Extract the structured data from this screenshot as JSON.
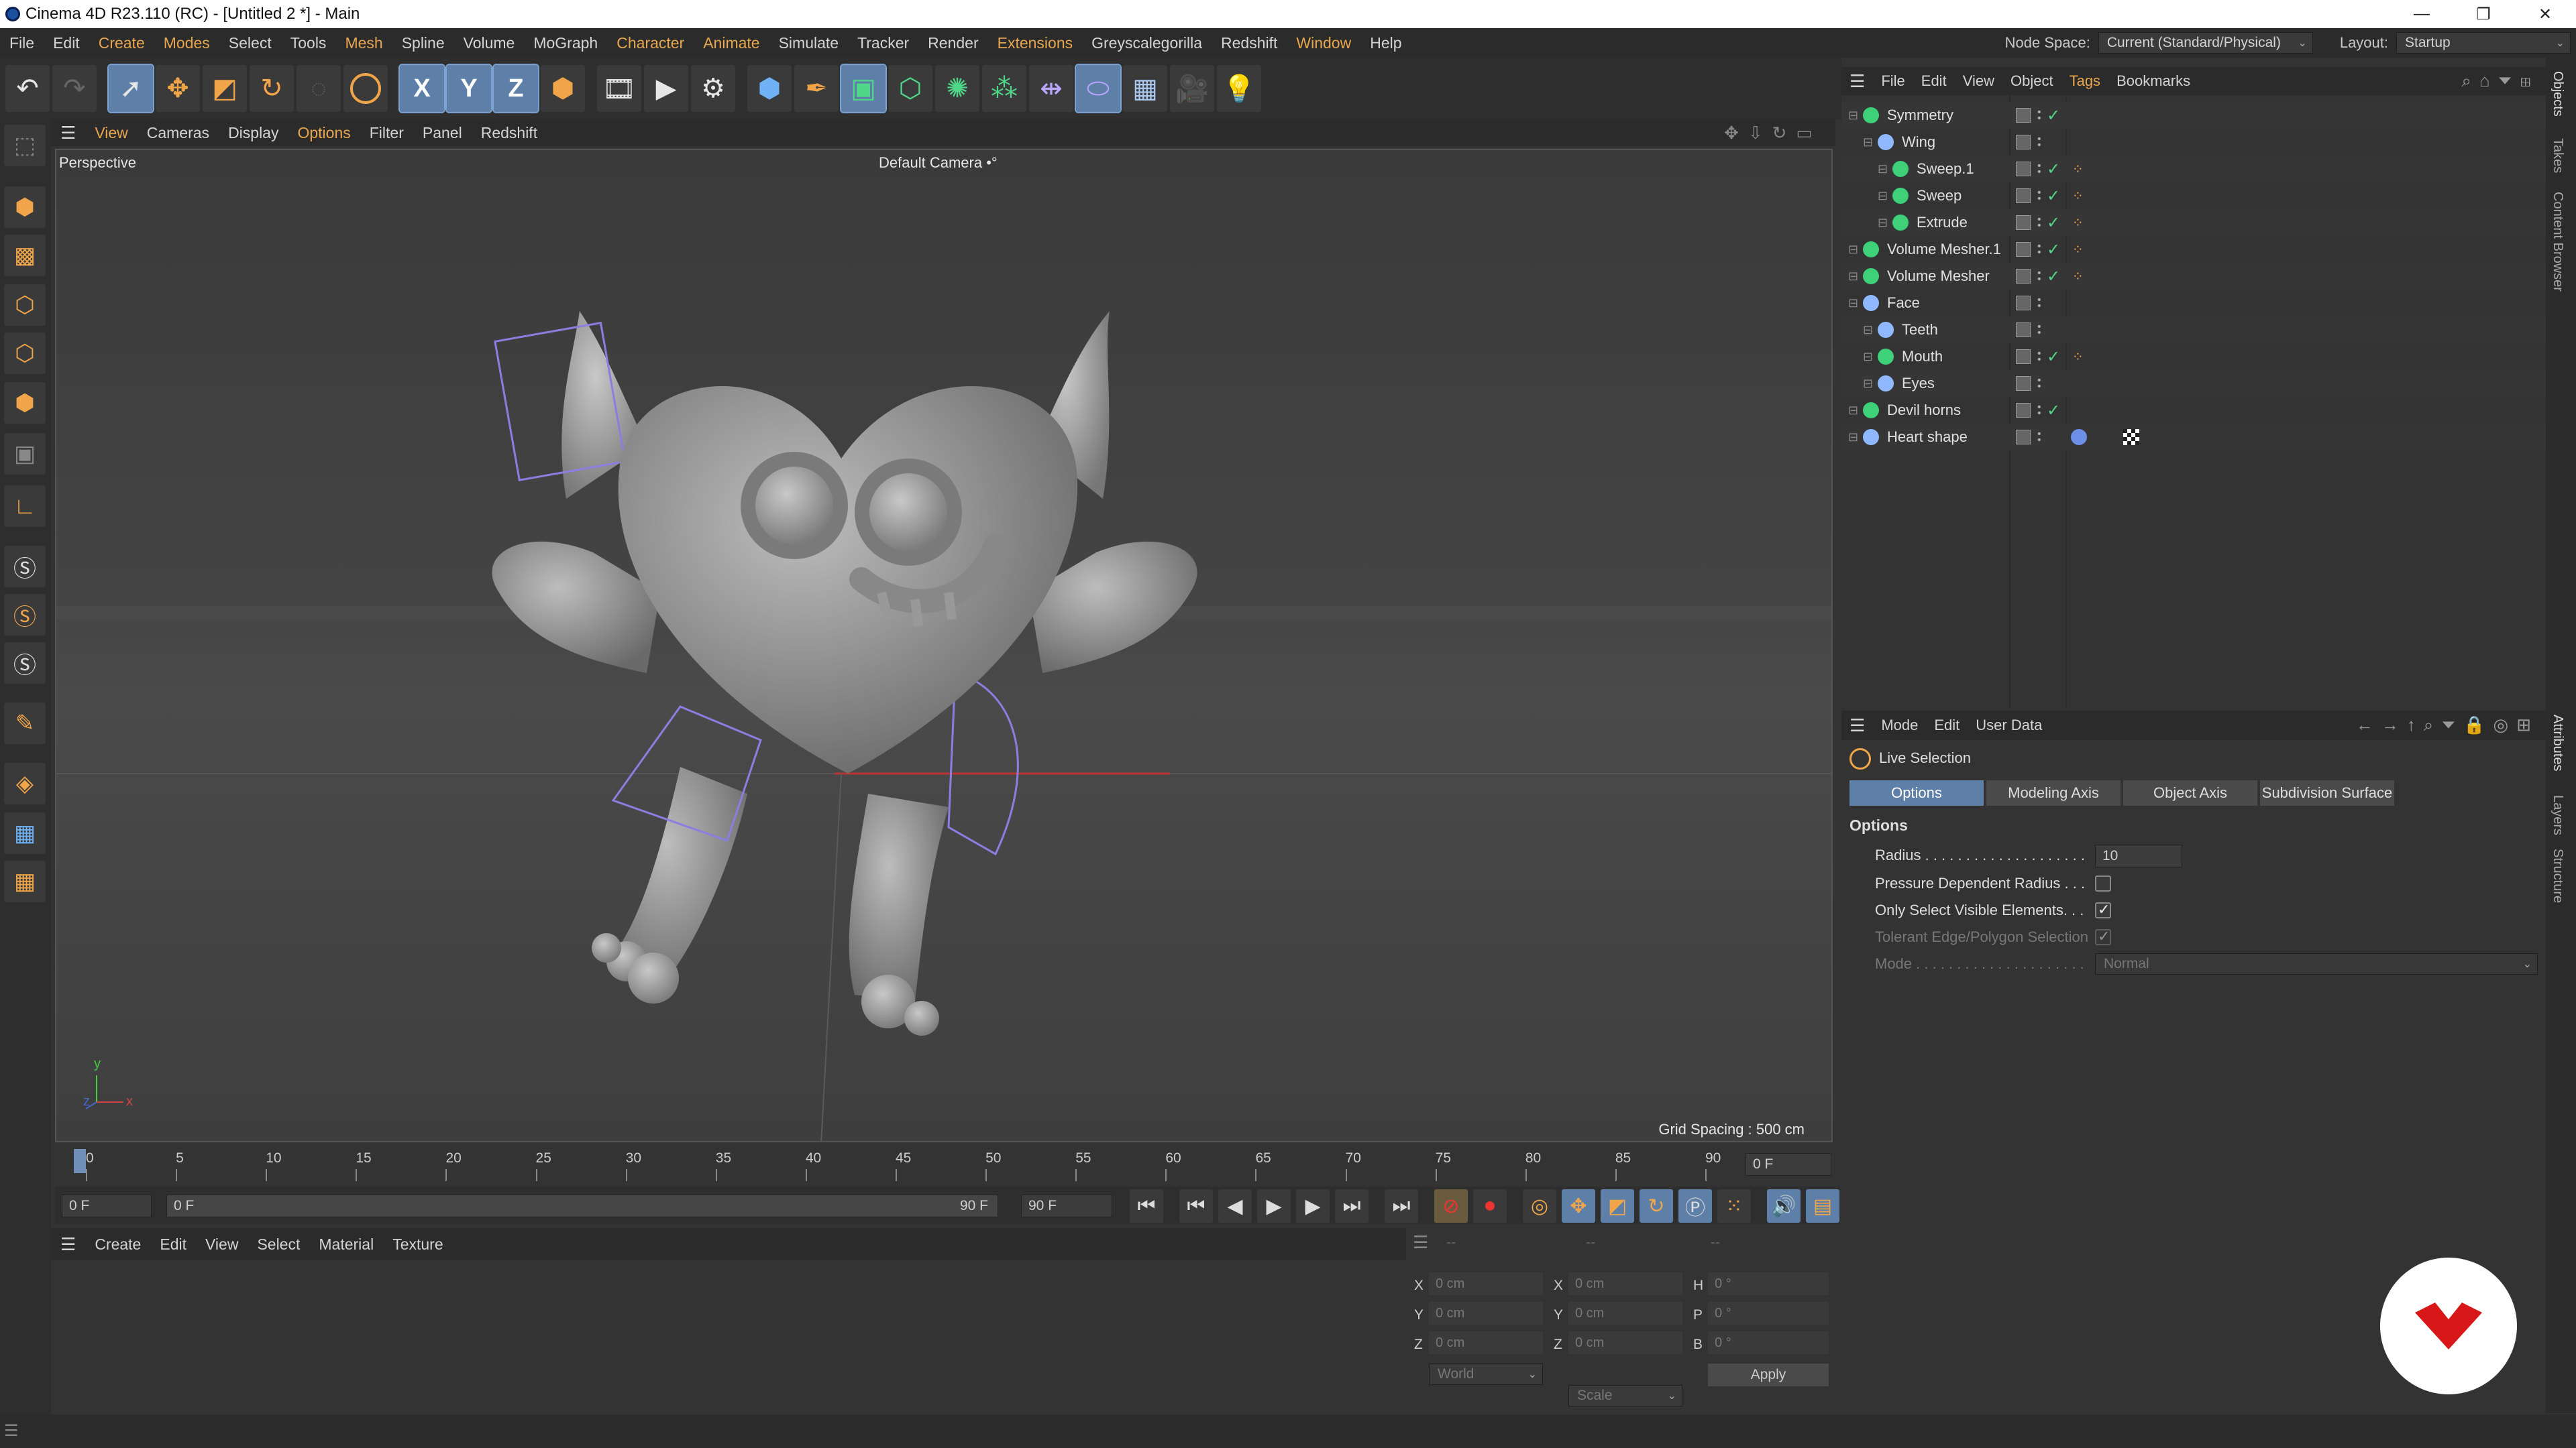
{
  "window": {
    "title": "Cinema 4D R23.110 (RC) - [Untitled 2 *] - Main",
    "controls": [
      "—",
      "❐",
      "✕"
    ]
  },
  "menubar": {
    "items": [
      "File",
      "Edit",
      "Create",
      "Modes",
      "Select",
      "Tools",
      "Mesh",
      "Spline",
      "Volume",
      "MoGraph",
      "Character",
      "Animate",
      "Simulate",
      "Tracker",
      "Render",
      "Extensions",
      "Greyscalegorilla",
      "Redshift",
      "Window",
      "Help"
    ],
    "accent_items": [
      "Create",
      "Mesh",
      "Character",
      "Animate",
      "Extensions"
    ],
    "node_space_label": "Node Space:",
    "node_space_value": "Current (Standard/Physical)",
    "layout_label": "Layout:",
    "layout_value": "Startup"
  },
  "toolbar": {
    "axis_x": "X",
    "axis_y": "Y",
    "axis_z": "Z",
    "icons": [
      "undo-icon",
      "redo-icon",
      "select-icon",
      "move-icon",
      "scale-icon",
      "rotate-icon",
      "recent-tool-icon",
      "live-selection-icon",
      "lock-x-icon",
      "lock-y-icon",
      "lock-z-icon",
      "coordinate-system-icon",
      "render-view-icon",
      "render-picture-viewer-icon",
      "render-settings-icon",
      "cube-icon",
      "pen-icon",
      "subdivision-icon",
      "extrude-icon",
      "cloner-icon",
      "array-icon",
      "symmetry-icon",
      "deformer-icon",
      "floor-icon",
      "camera-icon",
      "light-icon"
    ]
  },
  "viewport": {
    "menu": [
      "View",
      "Cameras",
      "Display",
      "Options",
      "Filter",
      "Panel",
      "Redshift"
    ],
    "accent_menu": [
      "Options"
    ],
    "label": "Perspective",
    "camera": "Default Camera",
    "camera_glyph": "•°",
    "grid_spacing": "Grid Spacing : 500 cm",
    "axis_x": "x",
    "axis_y": "y",
    "axis_z": "z"
  },
  "timeline": {
    "ticks": [
      "0",
      "5",
      "10",
      "15",
      "20",
      "25",
      "30",
      "35",
      "40",
      "45",
      "50",
      "55",
      "60",
      "65",
      "70",
      "75",
      "80",
      "85",
      "90"
    ],
    "current_frame": "0 F",
    "start_field": "0 F",
    "range_start": "0 F",
    "range_end": "90 F",
    "end_field": "90 F"
  },
  "material": {
    "menu": [
      "Create",
      "Edit",
      "View",
      "Select",
      "Material",
      "Texture"
    ]
  },
  "coords": {
    "placeholder_row": [
      "--",
      "--",
      "--"
    ],
    "rows": [
      {
        "a": "X",
        "av": "0 cm",
        "b": "X",
        "bv": "0 cm",
        "c": "H",
        "cv": "0 °"
      },
      {
        "a": "Y",
        "av": "0 cm",
        "b": "Y",
        "bv": "0 cm",
        "c": "P",
        "cv": "0 °"
      },
      {
        "a": "Z",
        "av": "0 cm",
        "b": "Z",
        "bv": "0 cm",
        "c": "B",
        "cv": "0 °"
      }
    ],
    "space": "World",
    "mode": "Scale",
    "apply": "Apply"
  },
  "objects": {
    "menu": [
      "File",
      "Edit",
      "View",
      "Object",
      "Tags",
      "Bookmarks"
    ],
    "accent_menu": [
      "Tags"
    ],
    "rows": [
      {
        "name": "Symmetry",
        "indent": 0,
        "icon": "symmetry-icon",
        "color": "#3fd07a",
        "check": true,
        "tags": ""
      },
      {
        "name": "Wing",
        "indent": 1,
        "icon": "null-icon",
        "color": "#8fb8ff",
        "check": false,
        "tags": ""
      },
      {
        "name": "Sweep.1",
        "indent": 2,
        "icon": "sweep-icon",
        "color": "#3fd07a",
        "check": true,
        "tags": "orange"
      },
      {
        "name": "Sweep",
        "indent": 2,
        "icon": "sweep-icon",
        "color": "#3fd07a",
        "check": true,
        "tags": "orange"
      },
      {
        "name": "Extrude",
        "indent": 2,
        "icon": "extrude-icon",
        "color": "#3fd07a",
        "check": true,
        "tags": "orange"
      },
      {
        "name": "Volume Mesher.1",
        "indent": 0,
        "icon": "volume-mesher-icon",
        "color": "#3fd07a",
        "check": true,
        "tags": "orange"
      },
      {
        "name": "Volume Mesher",
        "indent": 0,
        "icon": "volume-mesher-icon",
        "color": "#3fd07a",
        "check": true,
        "tags": "orange"
      },
      {
        "name": "Face",
        "indent": 0,
        "icon": "null-icon",
        "color": "#8fb8ff",
        "check": false,
        "tags": ""
      },
      {
        "name": "Teeth",
        "indent": 1,
        "icon": "null-icon",
        "color": "#8fb8ff",
        "check": false,
        "tags": ""
      },
      {
        "name": "Mouth",
        "indent": 1,
        "icon": "sweep-icon",
        "color": "#3fd07a",
        "check": true,
        "tags": "orange"
      },
      {
        "name": "Eyes",
        "indent": 1,
        "icon": "null-icon",
        "color": "#8fb8ff",
        "check": false,
        "tags": ""
      },
      {
        "name": "Devil horns",
        "indent": 0,
        "icon": "symmetry-icon",
        "color": "#3fd07a",
        "check": true,
        "tags": ""
      },
      {
        "name": "Heart shape",
        "indent": 0,
        "icon": "polygon-object-icon",
        "color": "#8fb8ff",
        "check": false,
        "tags": "material"
      }
    ]
  },
  "attributes": {
    "menu": [
      "Mode",
      "Edit",
      "User Data"
    ],
    "tool_name": "Live Selection",
    "tabs": [
      "Options",
      "Modeling Axis",
      "Object Axis",
      "Subdivision Surface"
    ],
    "active_tab": "Options",
    "section": "Options",
    "fields": {
      "radius_label": "Radius . . . . . . . . . . . . . . . . . . . .",
      "radius_value": "10",
      "pressure_label": "Pressure Dependent Radius . . .",
      "pressure_checked": false,
      "visible_label": "Only Select Visible Elements. . .",
      "visible_checked": true,
      "tolerant_label": "Tolerant Edge/Polygon Selection",
      "tolerant_checked": true,
      "mode_label": "Mode . . . . . . . . . . . . . . . . . . . . .",
      "mode_value": "Normal"
    }
  },
  "sidetabs": [
    "Objects",
    "Takes",
    "Content Browser",
    "Attributes",
    "Layers",
    "Structure"
  ],
  "colors": {
    "accent": "#e8a64e",
    "selection_blue": "#5d7fa8",
    "background": "#333333"
  }
}
